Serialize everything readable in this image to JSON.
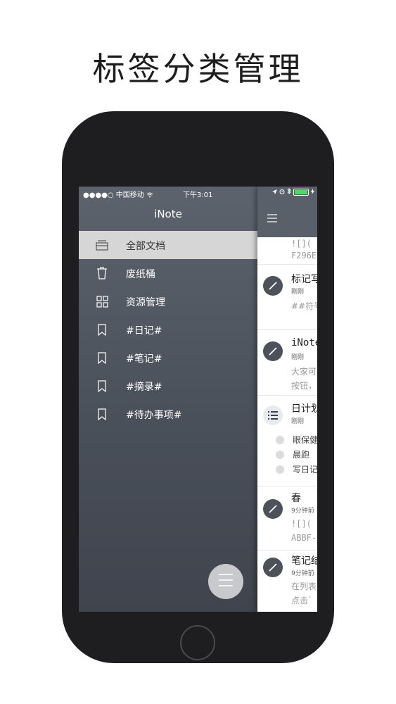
{
  "headline": "标签分类管理",
  "statusbar": {
    "carrier": "●●●●○ 中国移动",
    "time": "下午3:01"
  },
  "sidebar": {
    "title": "iNote",
    "items": [
      {
        "label": "全部文档",
        "icon": "tray-icon",
        "active": true
      },
      {
        "label": "废纸桶",
        "icon": "trash-icon",
        "active": false
      },
      {
        "label": "资源管理",
        "icon": "grid-icon",
        "active": false
      },
      {
        "label": "#日记#",
        "icon": "bookmark-icon",
        "active": false
      },
      {
        "label": "#笔记#",
        "icon": "bookmark-icon",
        "active": false
      },
      {
        "label": "#摘录#",
        "icon": "bookmark-icon",
        "active": false
      },
      {
        "label": "#待办事项#",
        "icon": "bookmark-icon",
        "active": false
      }
    ]
  },
  "notes": [
    {
      "title": "",
      "time": "",
      "lines": [
        "![](",
        "F296E"
      ]
    },
    {
      "title": "标记写",
      "time": "刚刚",
      "lines": [
        "##符号"
      ]
    },
    {
      "title": "iNote",
      "time": "刚刚",
      "lines": [
        "大家可",
        "按钮，"
      ]
    },
    {
      "title": "日计划",
      "time": "刚刚",
      "checklist": [
        "眼保健",
        "晨跑",
        "写日记"
      ]
    },
    {
      "title": "春",
      "time": "9分钟前",
      "lines": [
        "![](",
        "ABBF-"
      ]
    },
    {
      "title": "笔记结",
      "time": "9分钟前",
      "lines": [
        "在列表",
        "点击`"
      ]
    }
  ],
  "colors": {
    "sidebar_top": "#5c636d",
    "sidebar_bottom": "#3f444d",
    "active_row": "#d6d6d6",
    "fab": "#c7c9cd"
  }
}
